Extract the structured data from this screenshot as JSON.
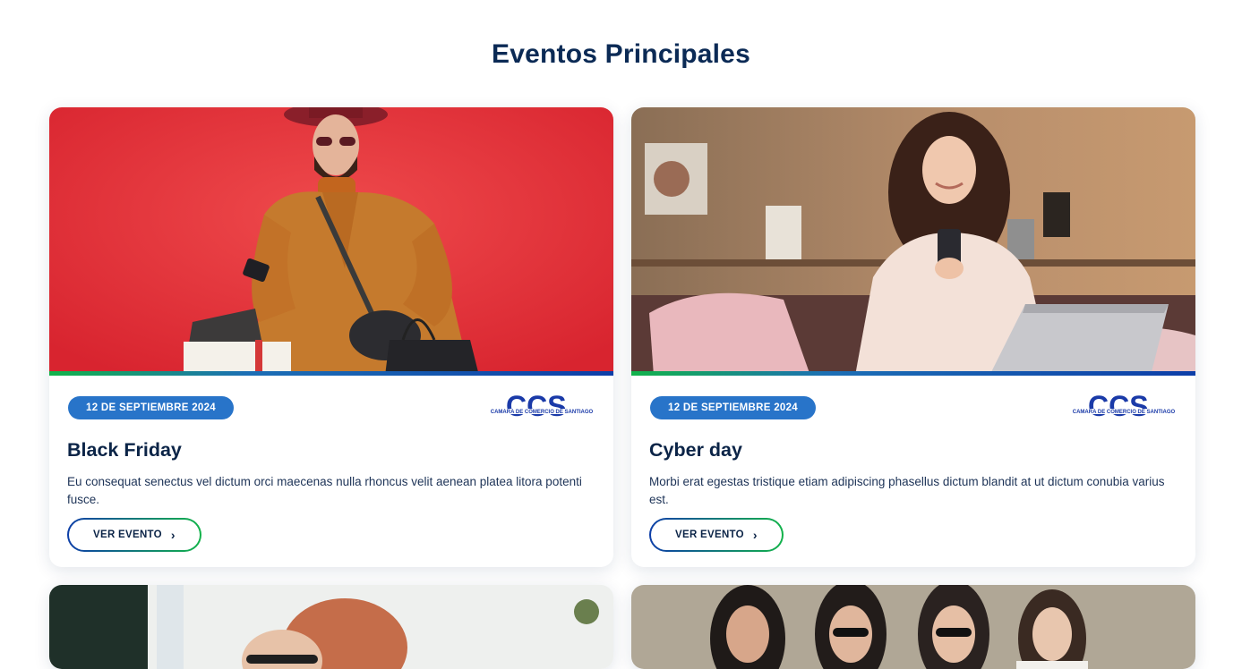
{
  "section": {
    "title": "Eventos Principales"
  },
  "cards": [
    {
      "date": "12 DE SEPTIEMBRE 2024",
      "title": "Black Friday",
      "description": "Eu consequat senectus vel dictum orci maecenas nulla rhoncus velit aenean platea litora potenti fusce.",
      "button": "VER EVENTO",
      "logo_text": "CCS",
      "logo_caption": "CAMARA DE COMERCIO DE SANTIAGO"
    },
    {
      "date": "12 DE SEPTIEMBRE 2024",
      "title": "Cyber day",
      "description": "Morbi erat egestas tristique etiam adipiscing phasellus dictum blandit at ut dictum conubia varius est.",
      "button": "VER EVENTO",
      "logo_text": "CCS",
      "logo_caption": "CAMARA DE COMERCIO DE SANTIAGO"
    }
  ],
  "icons": {
    "button_icon": "chevron-right-icon",
    "button_glyph": "›"
  },
  "colors": {
    "title": "#0b2a55",
    "badge": "#2874c9",
    "logo_blue": "#1a3aa8",
    "logo_green": "#12b34a"
  }
}
